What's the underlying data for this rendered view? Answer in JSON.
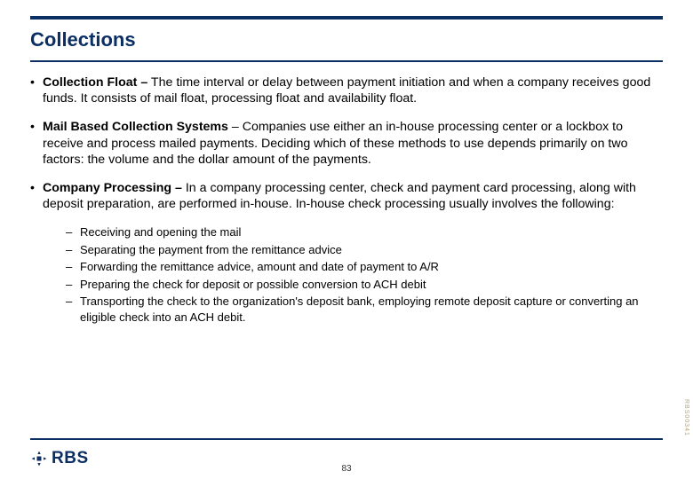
{
  "title": "Collections",
  "bullets": [
    {
      "label": "Collection Float –",
      "text": " The time interval or delay between payment initiation and when a company receives good funds. It consists of mail float, processing float and availability float."
    },
    {
      "label": "Mail Based Collection Systems",
      "text": " – Companies use either an in-house processing center or a lockbox to receive and process mailed payments. Deciding which of these methods to use depends primarily on two factors: the volume and the dollar amount of the payments."
    },
    {
      "label": "Company Processing –",
      "text": " In a company processing center, check and payment card processing, along with deposit preparation, are performed in-house. In-house check processing usually involves the following:"
    }
  ],
  "subitems": [
    "Receiving and opening the mail",
    "Separating the payment from the remittance advice",
    "Forwarding the remittance advice, amount and date of payment to A/R",
    "Preparing the check for deposit or possible conversion to ACH debit",
    "Transporting the check to the organization's deposit bank, employing remote deposit capture or converting an eligible check into an ACH debit."
  ],
  "logo_text": "RBS",
  "page_number": "83",
  "side_code": "RBS00341"
}
